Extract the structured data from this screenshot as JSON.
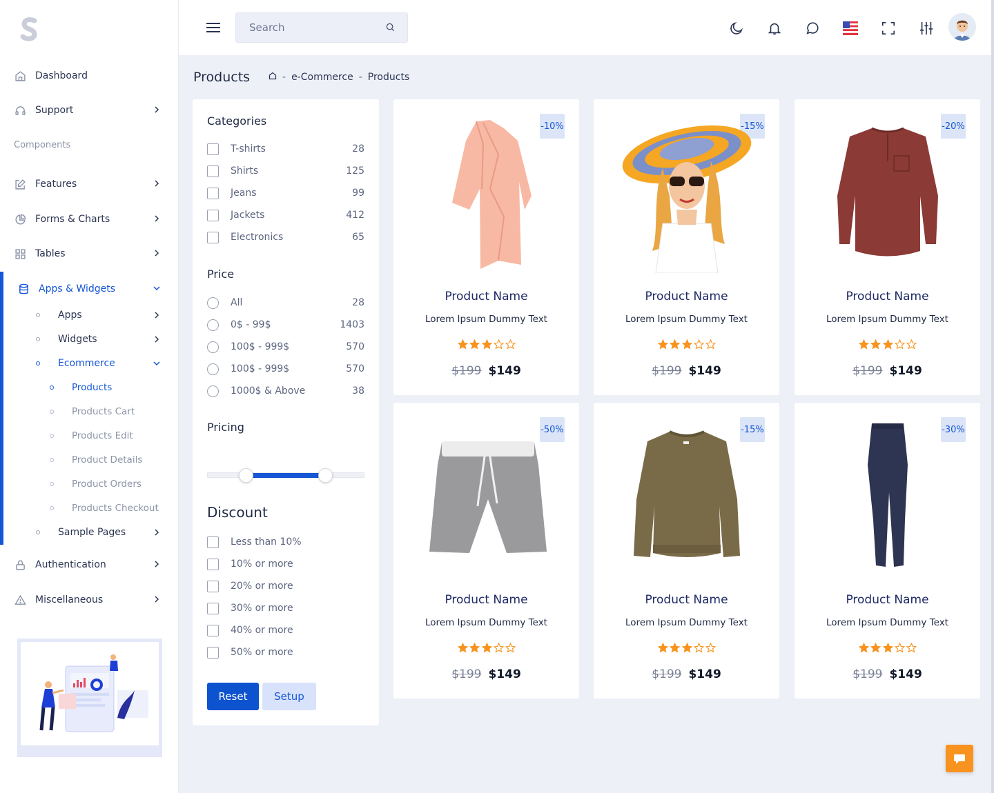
{
  "sidebar": {
    "items": {
      "dashboard": "Dashboard",
      "support": "Support",
      "components_section": "Components",
      "features": "Features",
      "forms_charts": "Forms & Charts",
      "tables": "Tables",
      "apps_widgets": "Apps & Widgets",
      "apps": "Apps",
      "widgets": "Widgets",
      "ecommerce": "Ecommerce",
      "products": "Products",
      "products_cart": "Products Cart",
      "products_edit": "Products Edit",
      "product_details": "Product Details",
      "product_orders": "Product Orders",
      "products_checkout": "Products Checkout",
      "sample_pages": "Sample Pages",
      "authentication": "Authentication",
      "miscellaneous": "Miscellaneous"
    }
  },
  "header": {
    "search_placeholder": "Search",
    "icons": [
      "menu-icon",
      "search-icon",
      "moon-icon",
      "bell-icon",
      "chat-icon",
      "us-flag-icon",
      "fullscreen-icon",
      "sliders-icon",
      "avatar"
    ]
  },
  "page": {
    "title": "Products",
    "breadcrumb": [
      "e-Commerce",
      "Products"
    ],
    "breadcrumb_sep": "-"
  },
  "filters": {
    "categories_title": "Categories",
    "categories": [
      {
        "label": "T-shirts",
        "count": "28"
      },
      {
        "label": "Shirts",
        "count": "125"
      },
      {
        "label": "Jeans",
        "count": "99"
      },
      {
        "label": "Jackets",
        "count": "412"
      },
      {
        "label": "Electronics",
        "count": "65"
      }
    ],
    "price_title": "Price",
    "prices": [
      {
        "label": "All",
        "count": "28"
      },
      {
        "label": "0$ - 99$",
        "count": "1403"
      },
      {
        "label": "100$ - 999$",
        "count": "570"
      },
      {
        "label": "100$ - 999$",
        "count": "570"
      },
      {
        "label": "1000$ & Above",
        "count": "38"
      }
    ],
    "pricing_title": "Pricing",
    "pricing_range_fraction": [
      0.25,
      0.75
    ],
    "discount_title": "Discount",
    "discounts": [
      "Less than 10%",
      "10% or more",
      "20% or more",
      "30% or more",
      "40% or more",
      "50% or more"
    ],
    "reset_label": "Reset",
    "setup_label": "Setup"
  },
  "products": [
    {
      "badge": "-10%",
      "name": "Product Name",
      "desc": "Lorem Ipsum Dummy Text",
      "rating": 3,
      "old_price": "$199",
      "price": "$149",
      "image": "peach-cardigan"
    },
    {
      "badge": "-15%",
      "name": "Product Name",
      "desc": "Lorem Ipsum Dummy Text",
      "rating": 3,
      "old_price": "$199",
      "price": "$149",
      "image": "woman-sun-hat"
    },
    {
      "badge": "-20%",
      "name": "Product Name",
      "desc": "Lorem Ipsum Dummy Text",
      "rating": 3,
      "old_price": "$199",
      "price": "$149",
      "image": "maroon-henley"
    },
    {
      "badge": "-50%",
      "name": "Product Name",
      "desc": "Lorem Ipsum Dummy Text",
      "rating": 3,
      "old_price": "$199",
      "price": "$149",
      "image": "grey-shorts"
    },
    {
      "badge": "-15%",
      "name": "Product Name",
      "desc": "Lorem Ipsum Dummy Text",
      "rating": 3,
      "old_price": "$199",
      "price": "$149",
      "image": "olive-sweatshirt"
    },
    {
      "badge": "-30%",
      "name": "Product Name",
      "desc": "Lorem Ipsum Dummy Text",
      "rating": 3,
      "old_price": "$199",
      "price": "$149",
      "image": "navy-jeans"
    }
  ],
  "colors": {
    "accent": "#1456d6",
    "star": "#f7931e",
    "badge_bg": "#dbe5f7",
    "page_bg": "#eef0f8"
  }
}
